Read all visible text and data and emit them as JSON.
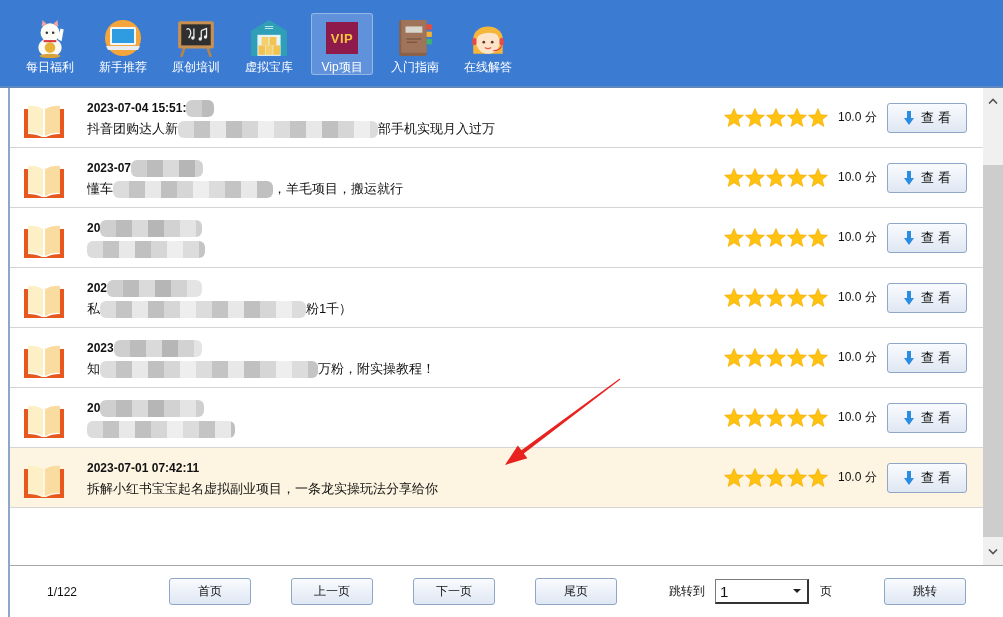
{
  "toolbar": {
    "items": [
      {
        "label": "每日福利",
        "kind": "lucky-cat",
        "selected": false
      },
      {
        "label": "新手推荐",
        "kind": "laptop",
        "selected": false
      },
      {
        "label": "原创培训",
        "kind": "chalkboard",
        "selected": false
      },
      {
        "label": "虚拟宝库",
        "kind": "warehouse",
        "selected": false
      },
      {
        "label": "Vip项目",
        "kind": "vip",
        "badge": "VIP",
        "selected": true
      },
      {
        "label": "入门指南",
        "kind": "notebook",
        "selected": false
      },
      {
        "label": "在线解答",
        "kind": "support",
        "selected": false
      }
    ]
  },
  "list": {
    "rows": [
      {
        "date": "2023-07-04 15:51:",
        "title_start": "抖音团购达人新",
        "title_end": "部手机实现月入过万",
        "blurred": true,
        "stars": 5,
        "score": "10.0 分",
        "button": "查看",
        "selected": false
      },
      {
        "date": "2023-07",
        "title_start": "懂车",
        "title_end": "，羊毛项目，搬运就行",
        "blurred": true,
        "stars": 5,
        "score": "10.0 分",
        "button": "查看",
        "selected": false
      },
      {
        "date": "20",
        "blurred": true,
        "stars": 5,
        "score": "10.0 分",
        "button": "查看",
        "selected": false
      },
      {
        "date": "202",
        "title_start": "私",
        "title_end": "粉1千）",
        "blurred": true,
        "stars": 5,
        "score": "10.0 分",
        "button": "查看",
        "selected": false
      },
      {
        "date": "2023",
        "title_start": "知",
        "title_end": "万粉，附实操教程！",
        "blurred": true,
        "stars": 5,
        "score": "10.0 分",
        "button": "查看",
        "selected": false
      },
      {
        "date": "20",
        "blurred": true,
        "stars": 5,
        "score": "10.0 分",
        "button": "查看",
        "selected": false
      },
      {
        "date": "2023-07-01 07:42:11",
        "title_start": "拆解小红书宝宝起名虚拟副业项目，一条龙实操玩法分享给你",
        "blurred": false,
        "stars": 5,
        "score": "10.0 分",
        "button": "查看",
        "selected": true
      }
    ]
  },
  "pagination": {
    "page_info": "1/122",
    "buttons": [
      "首页",
      "上一页",
      "下一页",
      "尾页"
    ],
    "jump_label": "跳转到",
    "page_select": {
      "value": "1"
    },
    "page_unit": "页",
    "jump_button": "跳转"
  }
}
